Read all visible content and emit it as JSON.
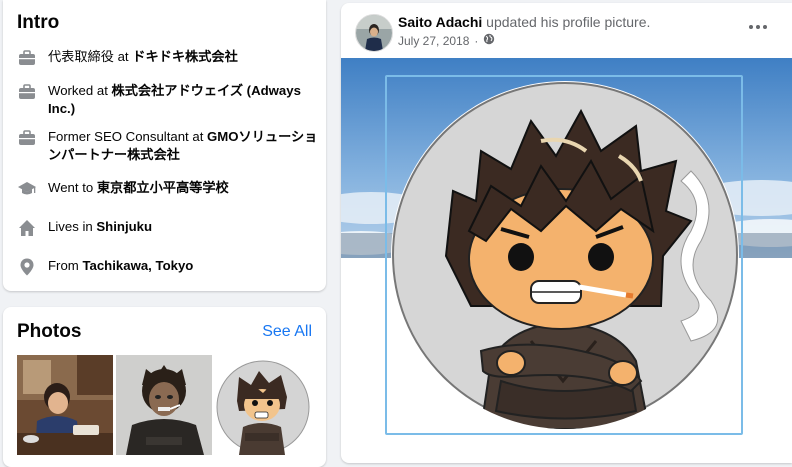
{
  "intro": {
    "title": "Intro",
    "items": [
      {
        "icon": "briefcase-icon",
        "prefix": "代表取締役 at ",
        "bold": "ドキドキ株式会社"
      },
      {
        "icon": "briefcase-icon",
        "prefix": "Worked at ",
        "bold": "株式会社アドウェイズ (Adways Inc.)"
      },
      {
        "icon": "briefcase-icon",
        "prefix": "Former SEO Consultant at ",
        "bold": "GMOソリューションパートナー株式会社"
      },
      {
        "icon": "graduation-cap-icon",
        "prefix": "Went to ",
        "bold": "東京都立小平高等学校"
      },
      {
        "icon": "house-icon",
        "prefix": "Lives in ",
        "bold": "Shinjuku"
      },
      {
        "icon": "location-pin-icon",
        "prefix": "From ",
        "bold": "Tachikawa, Tokyo"
      }
    ]
  },
  "photos": {
    "title": "Photos",
    "see_all": "See All"
  },
  "post": {
    "author": "Saito Adachi",
    "action": " updated his profile picture.",
    "date": "July 27, 2018",
    "privacy_icon": "globe-icon",
    "more_icon": "more-options-icon"
  },
  "colors": {
    "accent": "#1877f2",
    "secondary_text": "#65676b",
    "icon_gray": "#8a8d91",
    "frame_blue": "#7bbce8"
  }
}
